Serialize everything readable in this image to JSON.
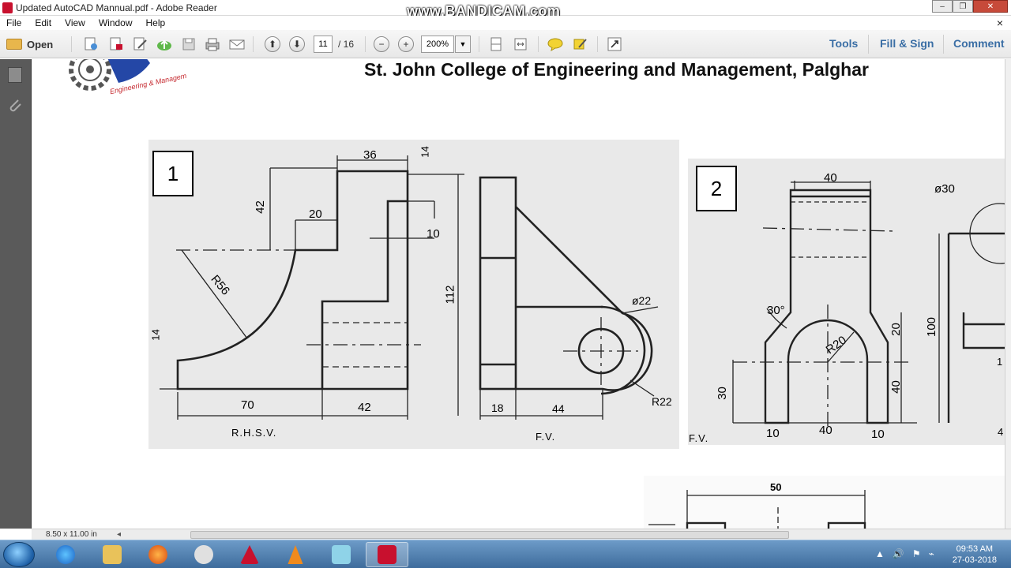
{
  "titlebar": {
    "title": "Updated AutoCAD Mannual.pdf - Adobe Reader",
    "watermark": "www.BANDICAM.com"
  },
  "menu": {
    "items": [
      "File",
      "Edit",
      "View",
      "Window",
      "Help"
    ],
    "close_glyph": "×"
  },
  "toolbar": {
    "open_label": "Open",
    "page_current": "11",
    "page_total": "/ 16",
    "zoom": "200%",
    "right_tabs": [
      "Tools",
      "Fill & Sign",
      "Comment"
    ]
  },
  "document": {
    "college_title": "St. John College of Engineering and Management, Palghar",
    "logo_text": "Engineering & Managem",
    "figure1": {
      "number": "1",
      "labels": {
        "d36": "36",
        "d14top": "14",
        "d42": "42",
        "d20": "20",
        "d10": "10",
        "d112": "112",
        "r56": "R56",
        "d14left": "14",
        "d70": "70",
        "d42bot": "42",
        "d18": "18",
        "d44": "44",
        "phi22": "ø22",
        "r22": "R22",
        "rhsv": "R.H.S.V.",
        "fv": "F.V."
      }
    },
    "figure2": {
      "number": "2",
      "labels": {
        "d40top": "40",
        "phi30": "ø30",
        "ang30": "30°",
        "r20": "R20",
        "d20": "20",
        "d100": "100",
        "d30": "30",
        "d40right": "40",
        "d10left": "10",
        "d40bot": "40",
        "d10right": "10",
        "fv": "F.V.",
        "d4": "4",
        "d1": "1"
      }
    },
    "figure3": {
      "labels": {
        "d50": "50"
      }
    }
  },
  "status": {
    "page_size": "8.50 x 11.00 in"
  },
  "taskbar": {
    "time": "09:53 AM",
    "date": "27-03-2018"
  },
  "colors": {
    "accent_tab": "#3a6ea5",
    "taskbar": "#3e6c9c",
    "acrobat_red": "#c8102e"
  }
}
